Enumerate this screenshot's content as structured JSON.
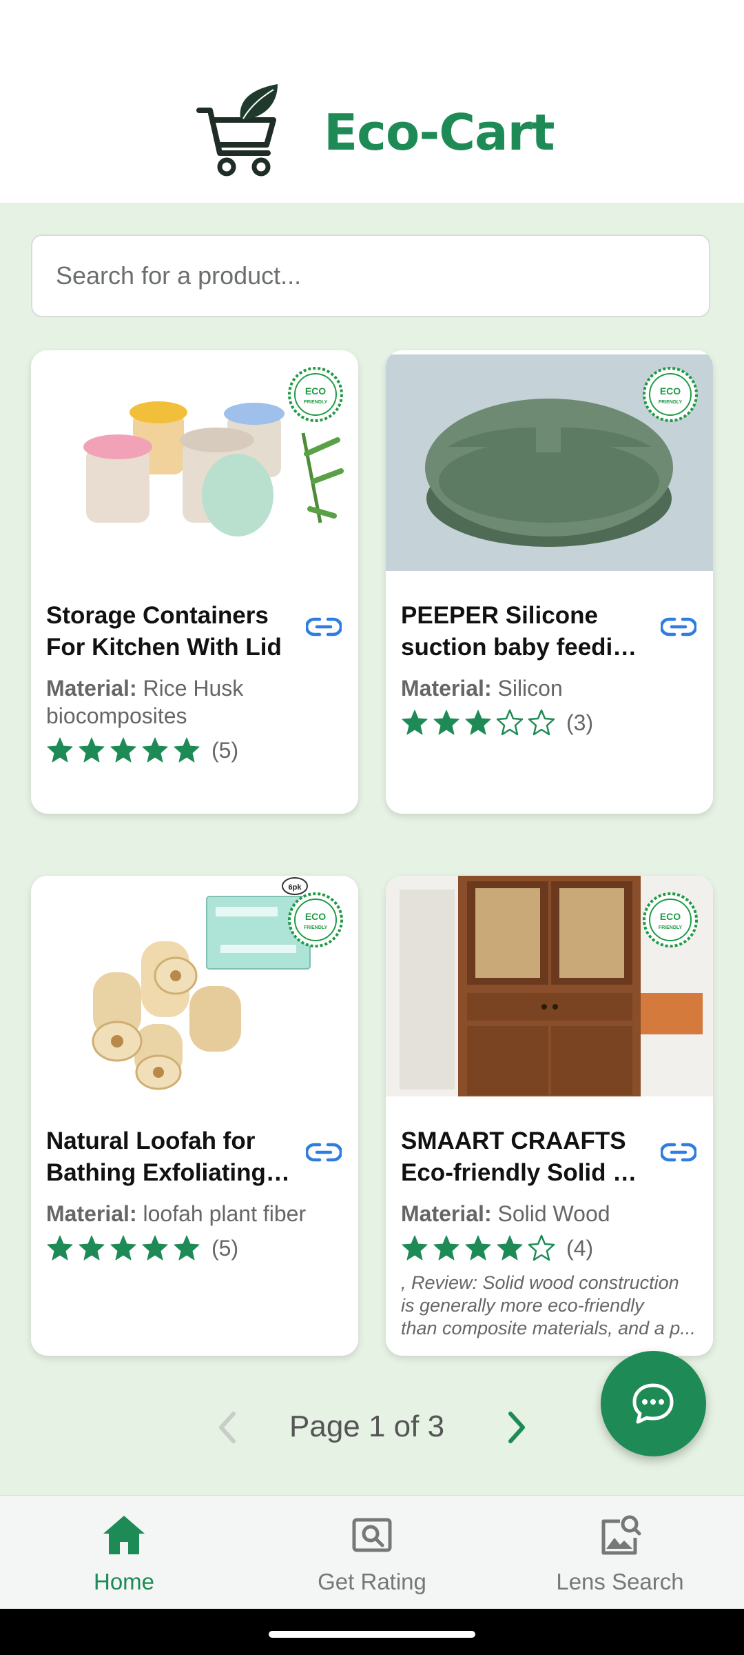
{
  "app": {
    "title": "Eco-Cart"
  },
  "search": {
    "placeholder": "Search for a product..."
  },
  "products": [
    {
      "name_line1": "Storage Containers",
      "name_line2": "For Kitchen With Lid",
      "material_label": "Material:",
      "material_line1": " Rice Husk",
      "material_line2": "biocomposites",
      "rating": 5,
      "count": "(5)",
      "badge_text": "ECO FRIENDLY"
    },
    {
      "name_line1": "PEEPER Silicone",
      "name_line2": "suction baby feeding plate",
      "material_label": "Material:",
      "material_line1": " Silicon",
      "material_line2": "",
      "rating": 3,
      "count": "(3)",
      "badge_text": "ECO FRIENDLY"
    },
    {
      "name_line1": "Natural Loofah for",
      "name_line2": "Bathing Exfoliating Scrubber",
      "material_label": "Material:",
      "material_line1": " loofah plant fiber",
      "material_line2": "",
      "rating": 5,
      "count": "(5)",
      "badge_text": "ECO FRIENDLY"
    },
    {
      "name_line1": "SMAART CRAAFTS",
      "name_line2": "Eco-friendly Solid Wood Cabinet",
      "material_label": "Material:",
      "material_line1": " Solid Wood",
      "material_line2": "",
      "rating": 4,
      "count": "(4)",
      "badge_text": "ECO FRIENDLY",
      "review_line1": ", Review: Solid wood construction",
      "review_line2": "is generally more eco-friendly",
      "review_line3": "than composite materials, and a p..."
    }
  ],
  "pager": {
    "label": "Page 1 of 3"
  },
  "nav": {
    "items": [
      {
        "label": "Home"
      },
      {
        "label": "Get Rating"
      },
      {
        "label": "Lens Search"
      }
    ]
  },
  "colors": {
    "brand": "#1e8a55",
    "background": "#e6f2e4",
    "link": "#2f7de1"
  }
}
